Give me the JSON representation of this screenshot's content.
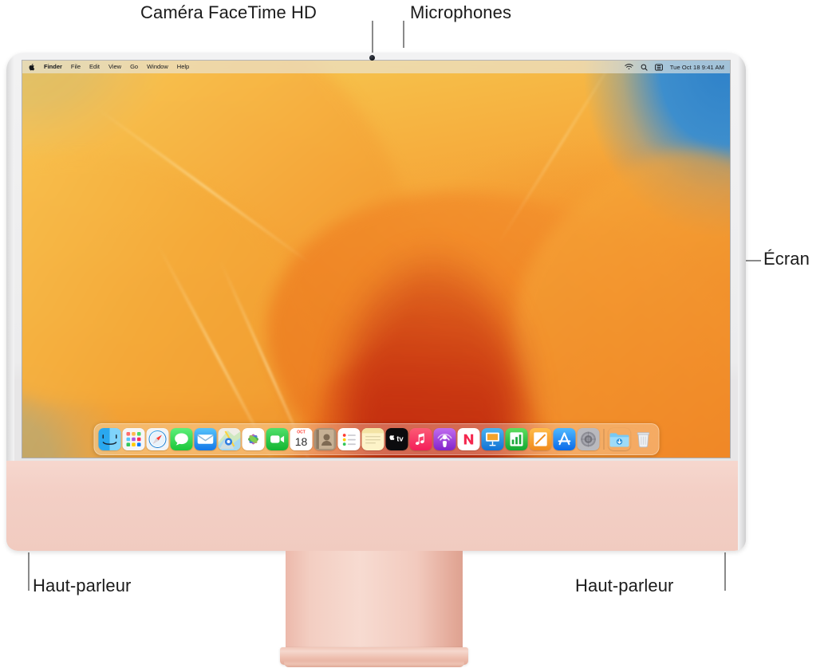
{
  "figure": {
    "subject": "iMac front view with labeled hardware features",
    "callouts": [
      {
        "id": "camera",
        "label": "Caméra FaceTime HD"
      },
      {
        "id": "microphones",
        "label": "Microphones"
      },
      {
        "id": "display",
        "label": "Écran"
      },
      {
        "id": "speaker_left",
        "label": "Haut-parleur"
      },
      {
        "id": "speaker_right",
        "label": "Haut-parleur"
      }
    ]
  },
  "screen": {
    "menubar": {
      "apple_icon": "apple-logo-icon",
      "items": [
        {
          "label": "Finder",
          "bold": true
        },
        {
          "label": "File",
          "bold": false
        },
        {
          "label": "Edit",
          "bold": false
        },
        {
          "label": "View",
          "bold": false
        },
        {
          "label": "Go",
          "bold": false
        },
        {
          "label": "Window",
          "bold": false
        },
        {
          "label": "Help",
          "bold": false
        }
      ],
      "status_icons": [
        "wifi-icon",
        "search-icon",
        "control-center-icon"
      ],
      "clock": "Tue Oct 18  9:41 AM"
    },
    "wallpaper": {
      "name": "macOS Ventura",
      "accent_orange": "#f0922c",
      "accent_blue": "#3f8ecf",
      "accent_red": "#c0260e",
      "accent_yellow": "#f7cc54"
    },
    "dock": {
      "items": [
        {
          "name": "Finder",
          "icon": "finder-icon",
          "running": true
        },
        {
          "name": "Launchpad",
          "icon": "launchpad-icon",
          "running": false
        },
        {
          "name": "Safari",
          "icon": "safari-icon",
          "running": false
        },
        {
          "name": "Messages",
          "icon": "messages-icon",
          "running": false
        },
        {
          "name": "Mail",
          "icon": "mail-icon",
          "running": false
        },
        {
          "name": "Maps",
          "icon": "maps-icon",
          "running": false
        },
        {
          "name": "Photos",
          "icon": "photos-icon",
          "running": false
        },
        {
          "name": "FaceTime",
          "icon": "facetime-icon",
          "running": false
        },
        {
          "name": "Calendar",
          "icon": "calendar-icon",
          "running": false,
          "month": "OCT",
          "day": "18"
        },
        {
          "name": "Contacts",
          "icon": "contacts-icon",
          "running": false
        },
        {
          "name": "Reminders",
          "icon": "reminders-icon",
          "running": false
        },
        {
          "name": "Notes",
          "icon": "notes-icon",
          "running": false
        },
        {
          "name": "Apple TV",
          "icon": "appletv-icon",
          "running": false
        },
        {
          "name": "Music",
          "icon": "music-icon",
          "running": false
        },
        {
          "name": "Podcasts",
          "icon": "podcasts-icon",
          "running": false
        },
        {
          "name": "News",
          "icon": "news-icon",
          "running": false
        },
        {
          "name": "Keynote",
          "icon": "keynote-icon",
          "running": false
        },
        {
          "name": "Numbers",
          "icon": "numbers-icon",
          "running": false
        },
        {
          "name": "Pages",
          "icon": "pages-icon",
          "running": false
        },
        {
          "name": "App Store",
          "icon": "appstore-icon",
          "running": false
        },
        {
          "name": "System Settings",
          "icon": "system-settings-icon",
          "running": false
        }
      ],
      "trailing": [
        {
          "name": "Downloads",
          "icon": "downloads-folder-icon"
        },
        {
          "name": "Trash",
          "icon": "trash-icon"
        }
      ]
    }
  },
  "hardware": {
    "body_color": "#f1cbc0",
    "bezel_color": "#ececed",
    "camera_dot": "camera-lens"
  }
}
